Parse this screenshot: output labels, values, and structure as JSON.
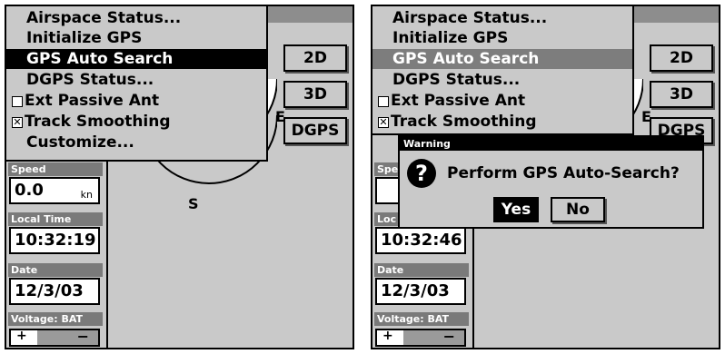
{
  "left": {
    "menu": {
      "items": [
        {
          "label": "Airspace Status...",
          "type": "item"
        },
        {
          "label": "Initialize GPS",
          "type": "item"
        },
        {
          "label": "GPS Auto Search",
          "type": "item",
          "selected": true
        },
        {
          "label": "DGPS Status...",
          "type": "item"
        },
        {
          "label": "Ext Passive Ant",
          "type": "checkbox",
          "checked": false
        },
        {
          "label": "Track Smoothing",
          "type": "checkbox",
          "checked": true
        },
        {
          "label": "Customize...",
          "type": "item"
        }
      ]
    },
    "modes": {
      "btn2d": "2D",
      "btn3d": "3D",
      "btndgps": "DGPS"
    },
    "compass": {
      "east": "E",
      "south": "S"
    },
    "fields": {
      "speed": {
        "label": "Speed",
        "value": "0.0",
        "unit": "kn"
      },
      "local_time": {
        "label": "Local Time",
        "value": "10:32:19"
      },
      "date": {
        "label": "Date",
        "value": "12/3/03"
      },
      "voltage": {
        "label": "Voltage: BAT",
        "plus": "+",
        "minus": "−"
      }
    }
  },
  "right": {
    "menu": {
      "items": [
        {
          "label": "Airspace Status...",
          "type": "item"
        },
        {
          "label": "Initialize GPS",
          "type": "item"
        },
        {
          "label": "GPS Auto Search",
          "type": "item",
          "selected": true
        },
        {
          "label": "DGPS Status...",
          "type": "item"
        },
        {
          "label": "Ext Passive Ant",
          "type": "checkbox",
          "checked": false
        },
        {
          "label": "Track Smoothing",
          "type": "checkbox",
          "checked": true
        }
      ]
    },
    "modes": {
      "btn2d": "2D",
      "btn3d": "3D",
      "btndgps": "DGPS"
    },
    "compass": {
      "east": "E"
    },
    "fields": {
      "speed": {
        "label": "Spe"
      },
      "local_time": {
        "label": "Loc",
        "value": "10:32:46"
      },
      "date": {
        "label": "Date",
        "value": "12/3/03"
      },
      "voltage": {
        "label": "Voltage: BAT",
        "plus": "+",
        "minus": "−"
      }
    },
    "dialog": {
      "title": "Warning",
      "icon": "question-icon",
      "icon_glyph": "?",
      "message": "Perform GPS Auto-Search?",
      "yes": "Yes",
      "no": "No"
    }
  }
}
